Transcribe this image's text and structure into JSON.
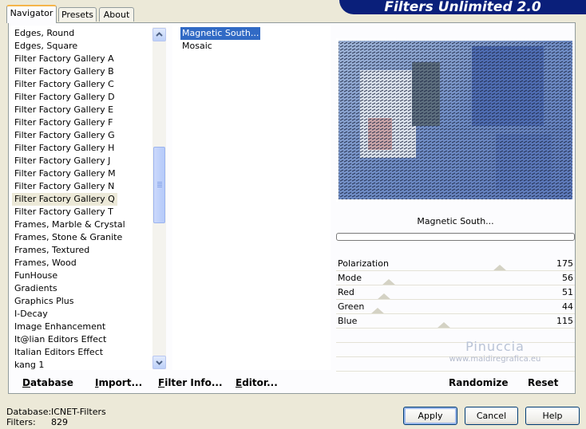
{
  "window": {
    "title": "Filters Unlimited 2.0"
  },
  "tabs": [
    {
      "label": "Navigator",
      "active": true
    },
    {
      "label": "Presets",
      "active": false
    },
    {
      "label": "About",
      "active": false
    }
  ],
  "filter_list": {
    "items": [
      "Edges, Round",
      "Edges, Square",
      "Filter Factory Gallery A",
      "Filter Factory Gallery B",
      "Filter Factory Gallery C",
      "Filter Factory Gallery D",
      "Filter Factory Gallery E",
      "Filter Factory Gallery F",
      "Filter Factory Gallery G",
      "Filter Factory Gallery H",
      "Filter Factory Gallery J",
      "Filter Factory Gallery M",
      "Filter Factory Gallery N",
      "Filter Factory Gallery Q",
      "Filter Factory Gallery T",
      "Frames, Marble & Crystal",
      "Frames, Stone & Granite",
      "Frames, Textured",
      "Frames, Wood",
      "FunHouse",
      "Gradients",
      "Graphics Plus",
      "I-Decay",
      "Image Enhancement",
      "It@lian Editors Effect",
      "Italian Editors Effect",
      "kang 1"
    ],
    "selected": "Filter Factory Gallery Q"
  },
  "effect_list": {
    "items": [
      "Magnetic South...",
      "Mosaic"
    ],
    "selected": "Magnetic South..."
  },
  "preview": {
    "effect_name": "Magnetic South...",
    "progress": 0
  },
  "parameters": [
    {
      "label": "Polarization",
      "value": "175",
      "level": 175
    },
    {
      "label": "Mode",
      "value": "56",
      "level": 56
    },
    {
      "label": "Red",
      "value": "51",
      "level": 51
    },
    {
      "label": "Green",
      "value": "44",
      "level": 44
    },
    {
      "label": "Blue",
      "value": "115",
      "level": 115
    }
  ],
  "watermark": {
    "name": "Pinuccia",
    "site": "www.maidiregrafica.eu"
  },
  "toolbar": {
    "database": {
      "accel": "D",
      "rest": "atabase"
    },
    "import": {
      "accel": "I",
      "rest": "mport..."
    },
    "filter_info": {
      "accel": "F",
      "rest": "ilter Info..."
    },
    "editor": {
      "accel": "E",
      "rest": "ditor..."
    },
    "randomize": "Randomize",
    "reset": "Reset"
  },
  "status": {
    "database_label": "Database:",
    "database_value": "ICNET-Filters",
    "filters_label": "Filters:",
    "filters_value": "829"
  },
  "buttons": {
    "apply": "Apply",
    "cancel": "Cancel",
    "help": "Help"
  },
  "colors": {
    "banner": "#0a1f7a",
    "selection": "#316ac5",
    "face": "#ece9d8"
  }
}
